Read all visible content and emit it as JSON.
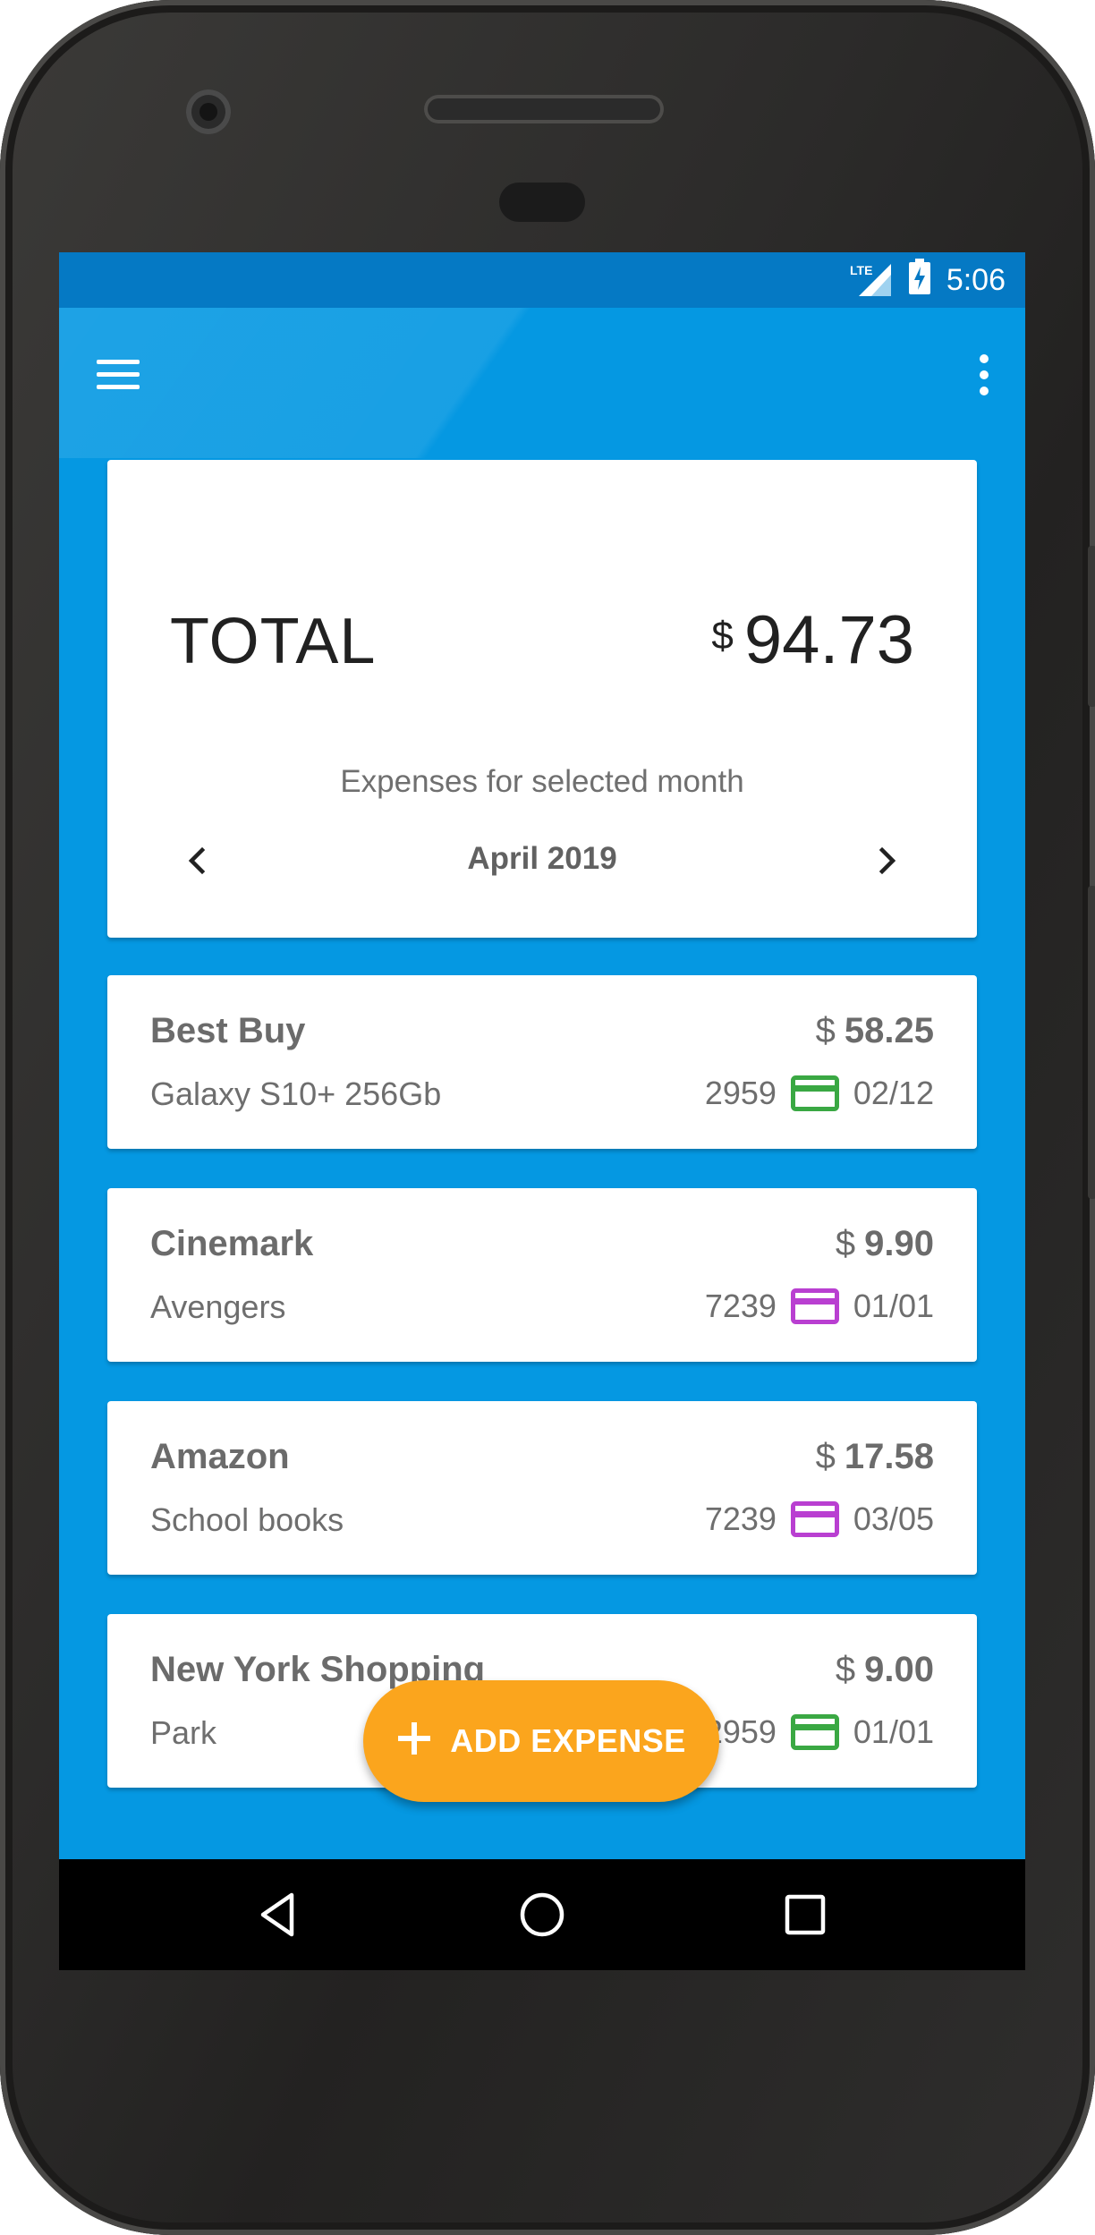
{
  "status_bar": {
    "network": "LTE",
    "time": "5:06",
    "icons": [
      "lte-signal-icon",
      "battery-charging-icon"
    ]
  },
  "toolbar": {
    "menu_icon": "hamburger-menu-icon",
    "overflow_icon": "more-vert-icon"
  },
  "summary": {
    "total_label": "TOTAL",
    "currency": "$",
    "total_amount": "94.73",
    "subtitle": "Expenses for selected month",
    "month": "April 2019"
  },
  "expenses": [
    {
      "name": "Best Buy",
      "description": "Galaxy S10+ 256Gb",
      "currency": "$",
      "amount": "58.25",
      "card_last4": "2959",
      "card_color": "#3aa843",
      "date": "02/12"
    },
    {
      "name": "Cinemark",
      "description": "Avengers",
      "currency": "$",
      "amount": "9.90",
      "card_last4": "7239",
      "card_color": "#b93fd1",
      "date": "01/01"
    },
    {
      "name": "Amazon",
      "description": "School books",
      "currency": "$",
      "amount": "17.58",
      "card_last4": "7239",
      "card_color": "#b93fd1",
      "date": "03/05"
    },
    {
      "name": "New York Shopping",
      "description": "Park",
      "currency": "$",
      "amount": "9.00",
      "card_last4": "2959",
      "card_color": "#3aa843",
      "date": "01/01"
    }
  ],
  "fab": {
    "icon": "plus-icon",
    "label": "ADD EXPENSE",
    "color": "#fba51d"
  },
  "nav_bar": {
    "buttons": [
      "back-icon",
      "home-icon",
      "recents-icon"
    ]
  },
  "theme": {
    "primary": "#0598e2",
    "primary_dark": "#0579c4"
  }
}
